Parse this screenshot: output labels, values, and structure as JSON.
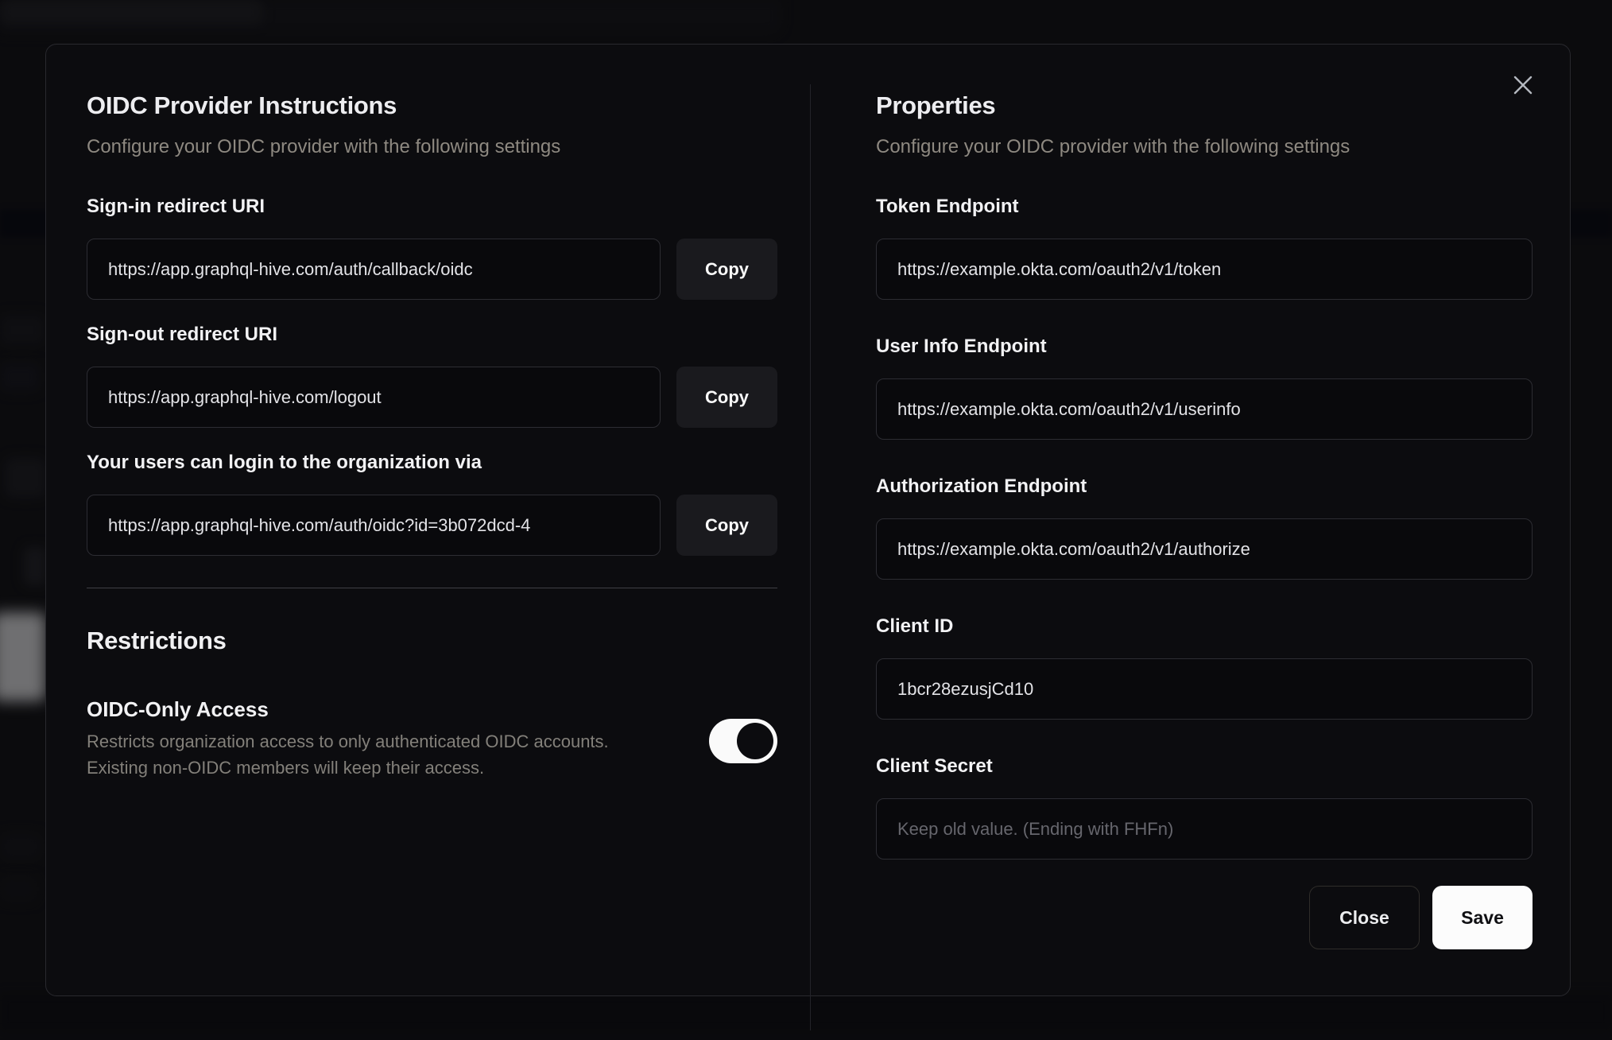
{
  "dialog": {
    "left": {
      "title": "OIDC Provider Instructions",
      "subtitle": "Configure your OIDC provider with the following settings",
      "fields": [
        {
          "label": "Sign-in redirect URI",
          "value": "https://app.graphql-hive.com/auth/callback/oidc",
          "button": "Copy"
        },
        {
          "label": "Sign-out redirect URI",
          "value": "https://app.graphql-hive.com/logout",
          "button": "Copy"
        },
        {
          "label": "Your users can login to the organization via",
          "value": "https://app.graphql-hive.com/auth/oidc?id=3b072dcd-4",
          "button": "Copy"
        }
      ],
      "restrictions": {
        "title": "Restrictions",
        "toggle_label": "OIDC-Only Access",
        "toggle_description_line1": "Restricts organization access to only authenticated OIDC accounts.",
        "toggle_description_line2": "Existing non-OIDC members will keep their access.",
        "toggle_state": "on"
      }
    },
    "right": {
      "title": "Properties",
      "subtitle": "Configure your OIDC provider with the following settings",
      "fields": [
        {
          "label": "Token Endpoint",
          "value": "https://example.okta.com/oauth2/v1/token"
        },
        {
          "label": "User Info Endpoint",
          "value": "https://example.okta.com/oauth2/v1/userinfo"
        },
        {
          "label": "Authorization Endpoint",
          "value": "https://example.okta.com/oauth2/v1/authorize"
        },
        {
          "label": "Client ID",
          "value": "1bcr28ezusjCd10"
        },
        {
          "label": "Client Secret",
          "value": "",
          "placeholder": "Keep old value. (Ending with FHFn)"
        }
      ],
      "buttons": {
        "close": "Close",
        "save": "Save"
      }
    },
    "icons": {
      "close": "x-mark"
    },
    "colors": {
      "save_button": "#fcfcfc",
      "toggle_on_track": "#fafafa",
      "toggle_knob": "#0c0c0f"
    }
  }
}
